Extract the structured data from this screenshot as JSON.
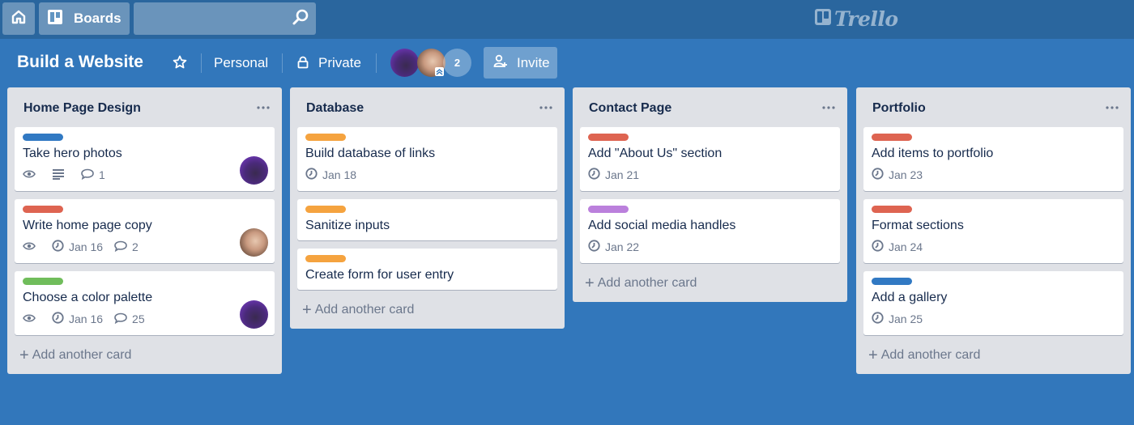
{
  "topbar": {
    "home_icon": "home-icon",
    "boards_label": "Boards",
    "search_placeholder": "",
    "logo_text": "Trello"
  },
  "board": {
    "title": "Build a Website",
    "team": "Personal",
    "visibility": "Private",
    "member_count": "2",
    "invite_label": "Invite"
  },
  "colors": {
    "label_blue": "#3179c3",
    "label_red": "#de6451",
    "label_green": "#70bd5b",
    "label_orange": "#f5a33f",
    "label_purple": "#bb80dc"
  },
  "lists": [
    {
      "title": "Home Page Design",
      "add_label": "Add another card",
      "cards": [
        {
          "label": "blue",
          "title": "Take hero photos",
          "watch": true,
          "description": true,
          "due": "",
          "comments": "1",
          "avatar": "purple"
        },
        {
          "label": "red",
          "title": "Write home page copy",
          "watch": true,
          "description": false,
          "due": "Jan 16",
          "comments": "2",
          "avatar": "bald"
        },
        {
          "label": "green",
          "title": "Choose a color palette",
          "watch": true,
          "description": false,
          "due": "Jan 16",
          "comments": "25",
          "avatar": "purple"
        }
      ]
    },
    {
      "title": "Database",
      "add_label": "Add another card",
      "cards": [
        {
          "label": "orange",
          "title": "Build database of links",
          "due": "Jan 18"
        },
        {
          "label": "orange",
          "title": "Sanitize inputs"
        },
        {
          "label": "orange",
          "title": "Create form for user entry"
        }
      ]
    },
    {
      "title": "Contact Page",
      "add_label": "Add another card",
      "cards": [
        {
          "label": "red",
          "title": "Add \"About Us\" section",
          "due": "Jan 21"
        },
        {
          "label": "purple",
          "title": "Add social media handles",
          "due": "Jan 22"
        }
      ]
    },
    {
      "title": "Portfolio",
      "add_label": "Add another card",
      "cards": [
        {
          "label": "red",
          "title": "Add items to portfolio",
          "due": "Jan 23"
        },
        {
          "label": "red",
          "title": "Format sections",
          "due": "Jan 24"
        },
        {
          "label": "blue",
          "title": "Add a gallery",
          "due": "Jan 25"
        }
      ]
    }
  ]
}
